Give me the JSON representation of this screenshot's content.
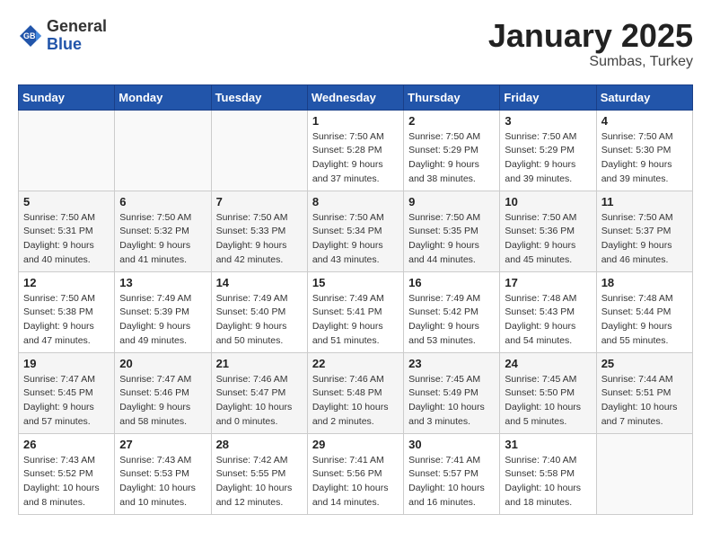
{
  "header": {
    "logo_general": "General",
    "logo_blue": "Blue",
    "month_title": "January 2025",
    "subtitle": "Sumbas, Turkey"
  },
  "weekdays": [
    "Sunday",
    "Monday",
    "Tuesday",
    "Wednesday",
    "Thursday",
    "Friday",
    "Saturday"
  ],
  "weeks": [
    {
      "days": [
        {
          "num": "",
          "info": ""
        },
        {
          "num": "",
          "info": ""
        },
        {
          "num": "",
          "info": ""
        },
        {
          "num": "1",
          "info": "Sunrise: 7:50 AM\nSunset: 5:28 PM\nDaylight: 9 hours and 37 minutes."
        },
        {
          "num": "2",
          "info": "Sunrise: 7:50 AM\nSunset: 5:29 PM\nDaylight: 9 hours and 38 minutes."
        },
        {
          "num": "3",
          "info": "Sunrise: 7:50 AM\nSunset: 5:29 PM\nDaylight: 9 hours and 39 minutes."
        },
        {
          "num": "4",
          "info": "Sunrise: 7:50 AM\nSunset: 5:30 PM\nDaylight: 9 hours and 39 minutes."
        }
      ]
    },
    {
      "days": [
        {
          "num": "5",
          "info": "Sunrise: 7:50 AM\nSunset: 5:31 PM\nDaylight: 9 hours and 40 minutes."
        },
        {
          "num": "6",
          "info": "Sunrise: 7:50 AM\nSunset: 5:32 PM\nDaylight: 9 hours and 41 minutes."
        },
        {
          "num": "7",
          "info": "Sunrise: 7:50 AM\nSunset: 5:33 PM\nDaylight: 9 hours and 42 minutes."
        },
        {
          "num": "8",
          "info": "Sunrise: 7:50 AM\nSunset: 5:34 PM\nDaylight: 9 hours and 43 minutes."
        },
        {
          "num": "9",
          "info": "Sunrise: 7:50 AM\nSunset: 5:35 PM\nDaylight: 9 hours and 44 minutes."
        },
        {
          "num": "10",
          "info": "Sunrise: 7:50 AM\nSunset: 5:36 PM\nDaylight: 9 hours and 45 minutes."
        },
        {
          "num": "11",
          "info": "Sunrise: 7:50 AM\nSunset: 5:37 PM\nDaylight: 9 hours and 46 minutes."
        }
      ]
    },
    {
      "days": [
        {
          "num": "12",
          "info": "Sunrise: 7:50 AM\nSunset: 5:38 PM\nDaylight: 9 hours and 47 minutes."
        },
        {
          "num": "13",
          "info": "Sunrise: 7:49 AM\nSunset: 5:39 PM\nDaylight: 9 hours and 49 minutes."
        },
        {
          "num": "14",
          "info": "Sunrise: 7:49 AM\nSunset: 5:40 PM\nDaylight: 9 hours and 50 minutes."
        },
        {
          "num": "15",
          "info": "Sunrise: 7:49 AM\nSunset: 5:41 PM\nDaylight: 9 hours and 51 minutes."
        },
        {
          "num": "16",
          "info": "Sunrise: 7:49 AM\nSunset: 5:42 PM\nDaylight: 9 hours and 53 minutes."
        },
        {
          "num": "17",
          "info": "Sunrise: 7:48 AM\nSunset: 5:43 PM\nDaylight: 9 hours and 54 minutes."
        },
        {
          "num": "18",
          "info": "Sunrise: 7:48 AM\nSunset: 5:44 PM\nDaylight: 9 hours and 55 minutes."
        }
      ]
    },
    {
      "days": [
        {
          "num": "19",
          "info": "Sunrise: 7:47 AM\nSunset: 5:45 PM\nDaylight: 9 hours and 57 minutes."
        },
        {
          "num": "20",
          "info": "Sunrise: 7:47 AM\nSunset: 5:46 PM\nDaylight: 9 hours and 58 minutes."
        },
        {
          "num": "21",
          "info": "Sunrise: 7:46 AM\nSunset: 5:47 PM\nDaylight: 10 hours and 0 minutes."
        },
        {
          "num": "22",
          "info": "Sunrise: 7:46 AM\nSunset: 5:48 PM\nDaylight: 10 hours and 2 minutes."
        },
        {
          "num": "23",
          "info": "Sunrise: 7:45 AM\nSunset: 5:49 PM\nDaylight: 10 hours and 3 minutes."
        },
        {
          "num": "24",
          "info": "Sunrise: 7:45 AM\nSunset: 5:50 PM\nDaylight: 10 hours and 5 minutes."
        },
        {
          "num": "25",
          "info": "Sunrise: 7:44 AM\nSunset: 5:51 PM\nDaylight: 10 hours and 7 minutes."
        }
      ]
    },
    {
      "days": [
        {
          "num": "26",
          "info": "Sunrise: 7:43 AM\nSunset: 5:52 PM\nDaylight: 10 hours and 8 minutes."
        },
        {
          "num": "27",
          "info": "Sunrise: 7:43 AM\nSunset: 5:53 PM\nDaylight: 10 hours and 10 minutes."
        },
        {
          "num": "28",
          "info": "Sunrise: 7:42 AM\nSunset: 5:55 PM\nDaylight: 10 hours and 12 minutes."
        },
        {
          "num": "29",
          "info": "Sunrise: 7:41 AM\nSunset: 5:56 PM\nDaylight: 10 hours and 14 minutes."
        },
        {
          "num": "30",
          "info": "Sunrise: 7:41 AM\nSunset: 5:57 PM\nDaylight: 10 hours and 16 minutes."
        },
        {
          "num": "31",
          "info": "Sunrise: 7:40 AM\nSunset: 5:58 PM\nDaylight: 10 hours and 18 minutes."
        },
        {
          "num": "",
          "info": ""
        }
      ]
    }
  ]
}
